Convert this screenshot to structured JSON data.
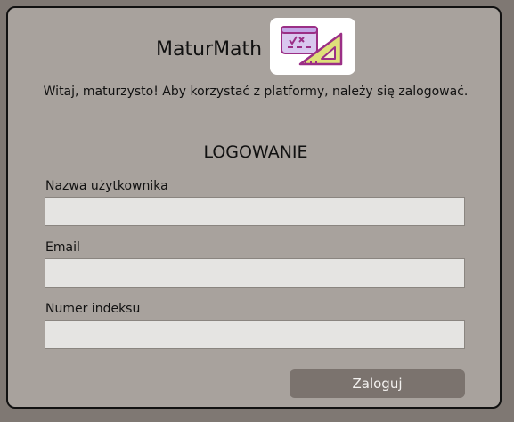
{
  "header": {
    "app_name": "MaturMath",
    "logo_icon": "geometry-formula-icon"
  },
  "welcome_text": "Witaj, maturzysto! Aby korzystać z platformy, należy się zalogować.",
  "form": {
    "title": "LOGOWANIE",
    "fields": [
      {
        "label": "Nazwa użytkownika",
        "value": "",
        "placeholder": ""
      },
      {
        "label": "Email",
        "value": "",
        "placeholder": ""
      },
      {
        "label": "Numer indeksu",
        "value": "",
        "placeholder": ""
      }
    ],
    "submit_label": "Zaloguj"
  },
  "colors": {
    "page_background": "#7f7873",
    "card_background": "#a8a29d",
    "input_background": "#e5e4e2",
    "button_background": "#7b736e",
    "logo_purple": "#9b2f86",
    "logo_yellow": "#dfe07a"
  }
}
